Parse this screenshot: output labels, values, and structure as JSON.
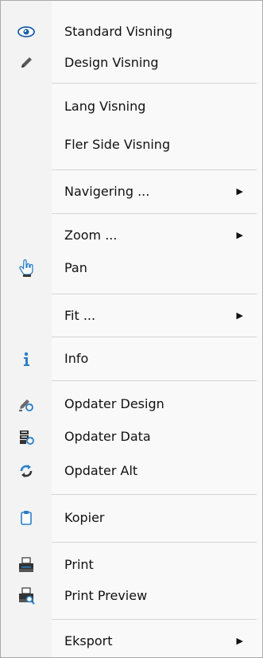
{
  "menu": {
    "items": [
      {
        "label": "Standard Visning",
        "icon": "eye-icon"
      },
      {
        "label": "Design Visning",
        "icon": "pencil-icon"
      },
      {
        "label": "Lang Visning",
        "icon": ""
      },
      {
        "label": "Fler Side Visning",
        "icon": ""
      },
      {
        "label": "Navigering ...",
        "icon": "",
        "submenu": true
      },
      {
        "label": "Zoom ...",
        "icon": "",
        "submenu": true
      },
      {
        "label": "Pan",
        "icon": "hand-pointer-icon"
      },
      {
        "label": "Fit ...",
        "icon": "",
        "submenu": true
      },
      {
        "label": "Info",
        "icon": "info-icon"
      },
      {
        "label": "Opdater Design",
        "icon": "refresh-design-icon"
      },
      {
        "label": "Opdater Data",
        "icon": "refresh-data-icon"
      },
      {
        "label": "Opdater Alt",
        "icon": "refresh-all-icon"
      },
      {
        "label": "Kopier",
        "icon": "copy-icon"
      },
      {
        "label": "Print",
        "icon": "printer-icon"
      },
      {
        "label": "Print Preview",
        "icon": "print-preview-icon"
      },
      {
        "label": "Eksport",
        "icon": "",
        "submenu": true
      }
    ],
    "submenu_arrow": "▶"
  }
}
